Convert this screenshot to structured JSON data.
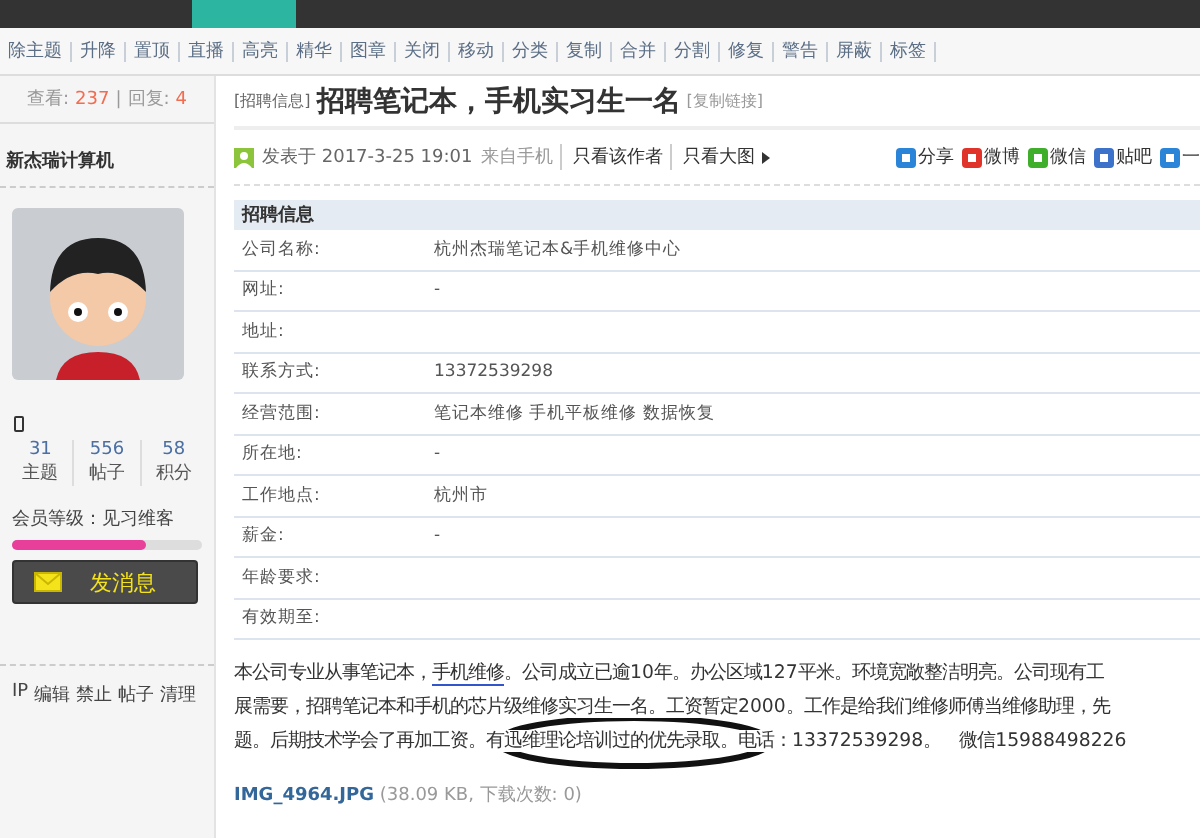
{
  "mod_tools": [
    "除主题",
    "升降",
    "置顶",
    "直播",
    "高亮",
    "精华",
    "图章",
    "关闭",
    "移动",
    "分类",
    "复制",
    "合并",
    "分割",
    "修复",
    "警告",
    "屏蔽",
    "标签"
  ],
  "stats": {
    "views_label": "查看:",
    "views": "237",
    "separator": "|",
    "replies_label": "回复:",
    "replies": "4"
  },
  "author": {
    "name": "新杰瑞计算机",
    "counts": [
      {
        "value": "31",
        "label": "主题"
      },
      {
        "value": "556",
        "label": "帖子"
      },
      {
        "value": "58",
        "label": "积分"
      }
    ],
    "level_text": "会员等级：见习维客",
    "level": 0.7,
    "message_button": "发消息",
    "admin_links": [
      "IP",
      "编辑",
      "禁止",
      "帖子",
      "清理"
    ]
  },
  "thread": {
    "category": "[招聘信息]",
    "title": "招聘笔记本，手机实习生一名",
    "copy_link": "[复制链接]"
  },
  "post_meta": {
    "posted": "发表于 2017-3-25 19:01",
    "source": "来自手机",
    "links": [
      "只看该作者",
      "只看大图"
    ]
  },
  "share": [
    {
      "kind": "share",
      "label": "分享"
    },
    {
      "kind": "weibo",
      "label": "微博"
    },
    {
      "kind": "wechat",
      "label": "微信"
    },
    {
      "kind": "tieba",
      "label": "贴吧"
    },
    {
      "kind": "more",
      "label": "一"
    }
  ],
  "info_table": {
    "title": "招聘信息",
    "rows": [
      {
        "label": "公司名称:",
        "value": "杭州杰瑞笔记本&手机维修中心"
      },
      {
        "label": "网址:",
        "value": "-"
      },
      {
        "label": "地址:"
      },
      {
        "label": "联系方式:",
        "value": "13372539298"
      },
      {
        "label": "经营范围:",
        "value": "笔记本维修 手机平板维修 数据恢复"
      },
      {
        "label": "所在地:",
        "value": "-"
      },
      {
        "label": "工作地点:",
        "value": "杭州市"
      },
      {
        "label": "薪金:",
        "value": "-"
      },
      {
        "label": "年龄要求:"
      },
      {
        "label": "有效期至:"
      }
    ]
  },
  "body": {
    "line1_before": "本公司专业从事笔记本，",
    "link": "手机维修",
    "line1_after": "。公司成立已逾10年。办公区域127平米。环境宽敞整洁明亮。公司现有工",
    "line2": "展需要，招聘笔记本和手机的芯片级维修实习生一名。工资暂定2000。工作是给我们维修师傅当维修助理，先",
    "line3": "题。后期技术学会了再加工资。有迅维理论培训过的优先录取。电话：13372539298。　微信15988498226"
  },
  "attachment": {
    "name": "IMG_4964.JPG",
    "info": "(38.09 KB, 下载次数: 0)"
  }
}
